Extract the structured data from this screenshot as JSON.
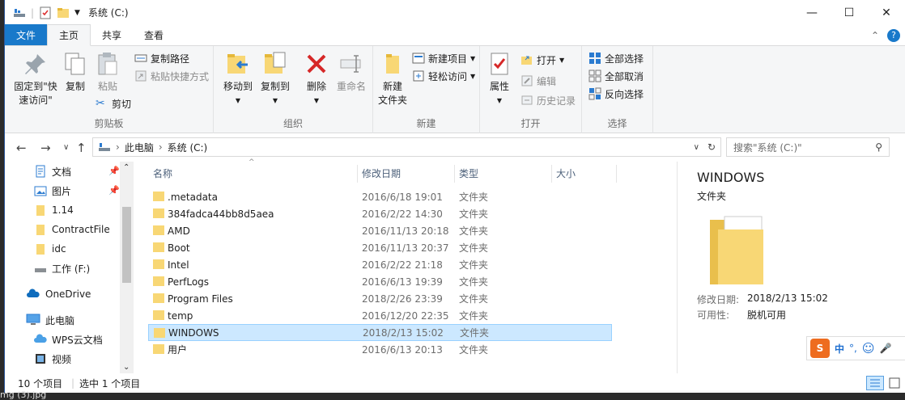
{
  "window": {
    "title": "系统 (C:)",
    "controls": {
      "minimize": "—",
      "maximize": "☐",
      "close": "✕"
    }
  },
  "tabs": [
    {
      "label": "文件"
    },
    {
      "label": "主页"
    },
    {
      "label": "共享"
    },
    {
      "label": "查看"
    }
  ],
  "ribbon": {
    "clipboard": {
      "label": "剪贴板",
      "pin_line1": "固定到\"快",
      "pin_line2": "速访问\"",
      "copy": "复制",
      "paste": "粘贴",
      "copy_path": "复制路径",
      "paste_shortcut": "粘贴快捷方式",
      "cut": "剪切"
    },
    "organize": {
      "label": "组织",
      "move_to": "移动到",
      "copy_to": "复制到",
      "delete": "删除",
      "rename": "重命名"
    },
    "new": {
      "label": "新建",
      "new_folder_line1": "新建",
      "new_folder_line2": "文件夹",
      "new_item": "新建项目",
      "easy_access": "轻松访问"
    },
    "open": {
      "label": "打开",
      "properties": "属性",
      "open": "打开",
      "edit": "编辑",
      "history": "历史记录"
    },
    "select": {
      "label": "选择",
      "select_all": "全部选择",
      "select_none": "全部取消",
      "invert": "反向选择"
    }
  },
  "address": {
    "path_root": "此电脑",
    "path_drive": "系统 (C:)",
    "search_placeholder": "搜索\"系统 (C:)\""
  },
  "nav": [
    {
      "label": "文档",
      "pinned": true
    },
    {
      "label": "图片",
      "pinned": true
    },
    {
      "label": "1.14"
    },
    {
      "label": "ContractFile"
    },
    {
      "label": "idc"
    },
    {
      "label": "工作 (F:)"
    },
    {
      "label": "OneDrive"
    },
    {
      "label": "此电脑"
    },
    {
      "label": "WPS云文档"
    },
    {
      "label": "视频"
    }
  ],
  "columns": {
    "name": "名称",
    "date": "修改日期",
    "type": "类型",
    "size": "大小"
  },
  "files": [
    {
      "name": ".metadata",
      "date": "2016/6/18 19:01",
      "type": "文件夹"
    },
    {
      "name": "384fadca44bb8d5aea",
      "date": "2016/2/22 14:30",
      "type": "文件夹"
    },
    {
      "name": "AMD",
      "date": "2016/11/13 20:18",
      "type": "文件夹"
    },
    {
      "name": "Boot",
      "date": "2016/11/13 20:37",
      "type": "文件夹"
    },
    {
      "name": "Intel",
      "date": "2016/2/22 21:18",
      "type": "文件夹"
    },
    {
      "name": "PerfLogs",
      "date": "2016/6/13 19:39",
      "type": "文件夹"
    },
    {
      "name": "Program Files",
      "date": "2018/2/26 23:39",
      "type": "文件夹"
    },
    {
      "name": "temp",
      "date": "2016/12/20 22:35",
      "type": "文件夹"
    },
    {
      "name": "WINDOWS",
      "date": "2018/2/13 15:02",
      "type": "文件夹"
    },
    {
      "name": "用户",
      "date": "2016/6/13 20:13",
      "type": "文件夹"
    }
  ],
  "preview": {
    "title": "WINDOWS",
    "subtitle": "文件夹",
    "modified_label": "修改日期:",
    "modified_value": "2018/2/13 15:02",
    "availability_label": "可用性:",
    "availability_value": "脱机可用"
  },
  "status": {
    "count": "10 个项目",
    "selected": "选中 1 个项目"
  },
  "ime": {
    "lang": "中",
    "punct": "°,"
  },
  "taskbar_text": "mg (3).jpg",
  "colors": {
    "accent": "#1979ca",
    "selection": "#cce8ff",
    "folder": "#f8d775"
  }
}
